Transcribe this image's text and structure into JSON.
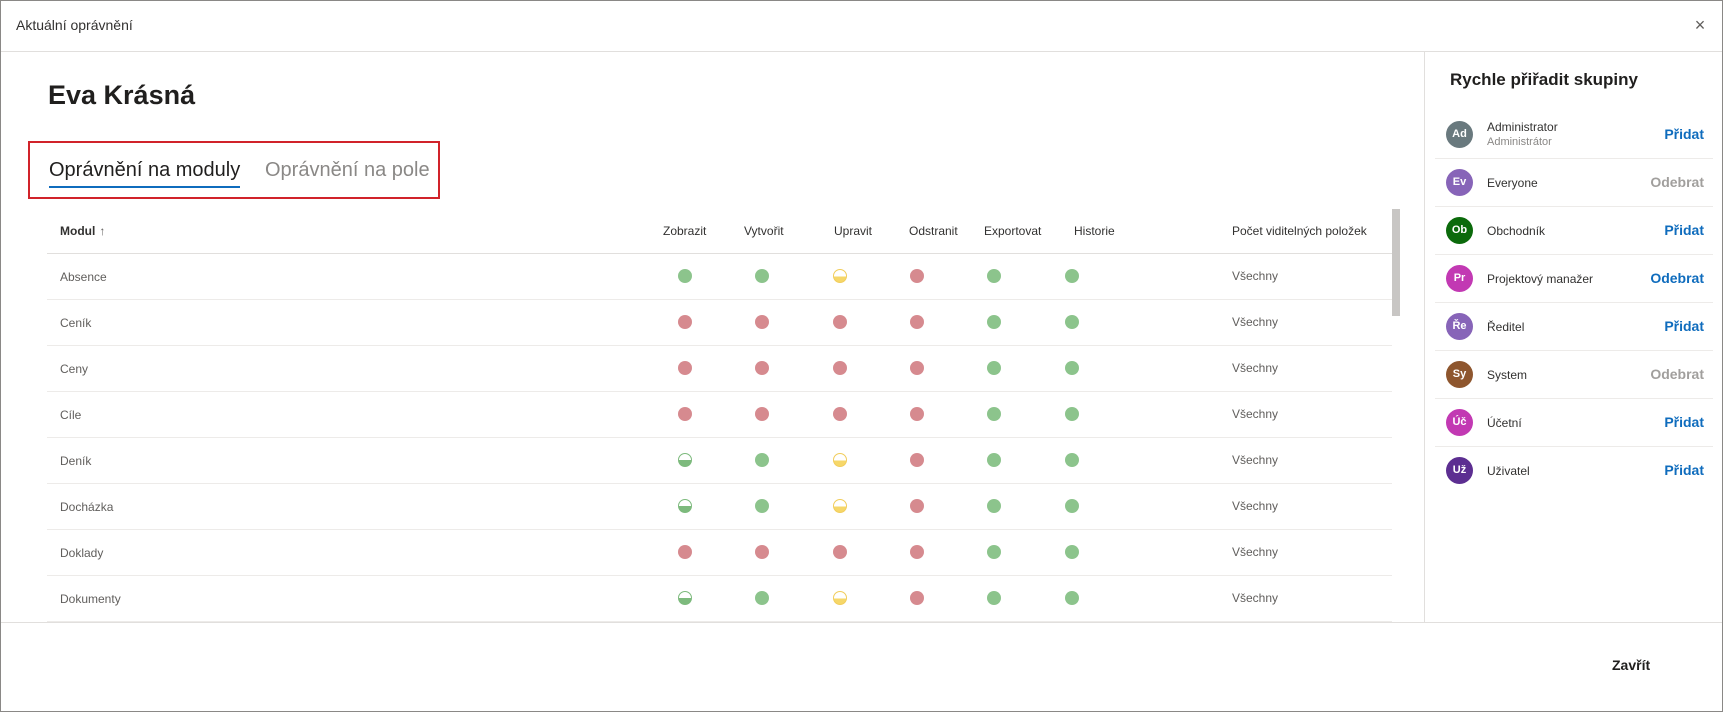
{
  "dialog": {
    "title": "Aktuální oprávnění",
    "close_symbol": "×"
  },
  "user": {
    "name": "Eva Krásná"
  },
  "tabs": [
    {
      "label": "Oprávnění na moduly",
      "active": true
    },
    {
      "label": "Oprávnění na pole",
      "active": false
    }
  ],
  "table": {
    "headers": {
      "modul": "Modul",
      "zobrazit": "Zobrazit",
      "vytvorit": "Vytvořit",
      "upravit": "Upravit",
      "odstranit": "Odstranit",
      "exportovat": "Exportovat",
      "historie": "Historie",
      "pocet": "Počet viditelných položek"
    },
    "rows": [
      {
        "name": "Absence",
        "perms": [
          "green",
          "green",
          "half-yellow",
          "red",
          "green",
          "green"
        ],
        "count": "Všechny"
      },
      {
        "name": "Ceník",
        "perms": [
          "red",
          "red",
          "red",
          "red",
          "green",
          "green"
        ],
        "count": "Všechny"
      },
      {
        "name": "Ceny",
        "perms": [
          "red",
          "red",
          "red",
          "red",
          "green",
          "green"
        ],
        "count": "Všechny"
      },
      {
        "name": "Cíle",
        "perms": [
          "red",
          "red",
          "red",
          "red",
          "green",
          "green"
        ],
        "count": "Všechny"
      },
      {
        "name": "Deník",
        "perms": [
          "half-green",
          "green",
          "half-yellow",
          "red",
          "green",
          "green"
        ],
        "count": "Všechny"
      },
      {
        "name": "Docházka",
        "perms": [
          "half-green",
          "green",
          "half-yellow",
          "red",
          "green",
          "green"
        ],
        "count": "Všechny"
      },
      {
        "name": "Doklady",
        "perms": [
          "red",
          "red",
          "red",
          "red",
          "green",
          "green"
        ],
        "count": "Všechny"
      },
      {
        "name": "Dokumenty",
        "perms": [
          "half-green",
          "green",
          "half-yellow",
          "red",
          "green",
          "green"
        ],
        "count": "Všechny"
      }
    ]
  },
  "quick_groups": {
    "title": "Rychle přiřadit skupiny",
    "items": [
      {
        "initials": "Ad",
        "name": "Administrator",
        "subtitle": "Administrátor",
        "action": "Přidat",
        "state": "add",
        "color": "#69797e"
      },
      {
        "initials": "Ev",
        "name": "Everyone",
        "subtitle": "",
        "action": "Odebrat",
        "state": "remove-disabled",
        "color": "#8764b8"
      },
      {
        "initials": "Ob",
        "name": "Obchodník",
        "subtitle": "",
        "action": "Přidat",
        "state": "add",
        "color": "#0b6a0b"
      },
      {
        "initials": "Pr",
        "name": "Projektový manažer",
        "subtitle": "",
        "action": "Odebrat",
        "state": "remove-active",
        "color": "#c239b3"
      },
      {
        "initials": "Ře",
        "name": "Ředitel",
        "subtitle": "",
        "action": "Přidat",
        "state": "add",
        "color": "#8764b8"
      },
      {
        "initials": "Sy",
        "name": "System",
        "subtitle": "",
        "action": "Odebrat",
        "state": "remove-disabled",
        "color": "#8e562e"
      },
      {
        "initials": "Úč",
        "name": "Účetní",
        "subtitle": "",
        "action": "Přidat",
        "state": "add",
        "color": "#c239b3"
      },
      {
        "initials": "Už",
        "name": "Uživatel",
        "subtitle": "",
        "action": "Přidat",
        "state": "add",
        "color": "#5c2e91"
      }
    ]
  },
  "footer": {
    "close_label": "Zavřít"
  },
  "colors": {
    "accent": "#0f6cbd",
    "highlight_border": "#d1232a",
    "allowed": "#8cc48c",
    "denied": "#d68a8f",
    "partial_yellow": "#f6d769"
  },
  "legend_icons": {
    "green": "full-access-dot-icon",
    "red": "no-access-dot-icon",
    "half-green": "partial-access-green-dot-icon",
    "half-yellow": "partial-access-yellow-dot-icon"
  }
}
